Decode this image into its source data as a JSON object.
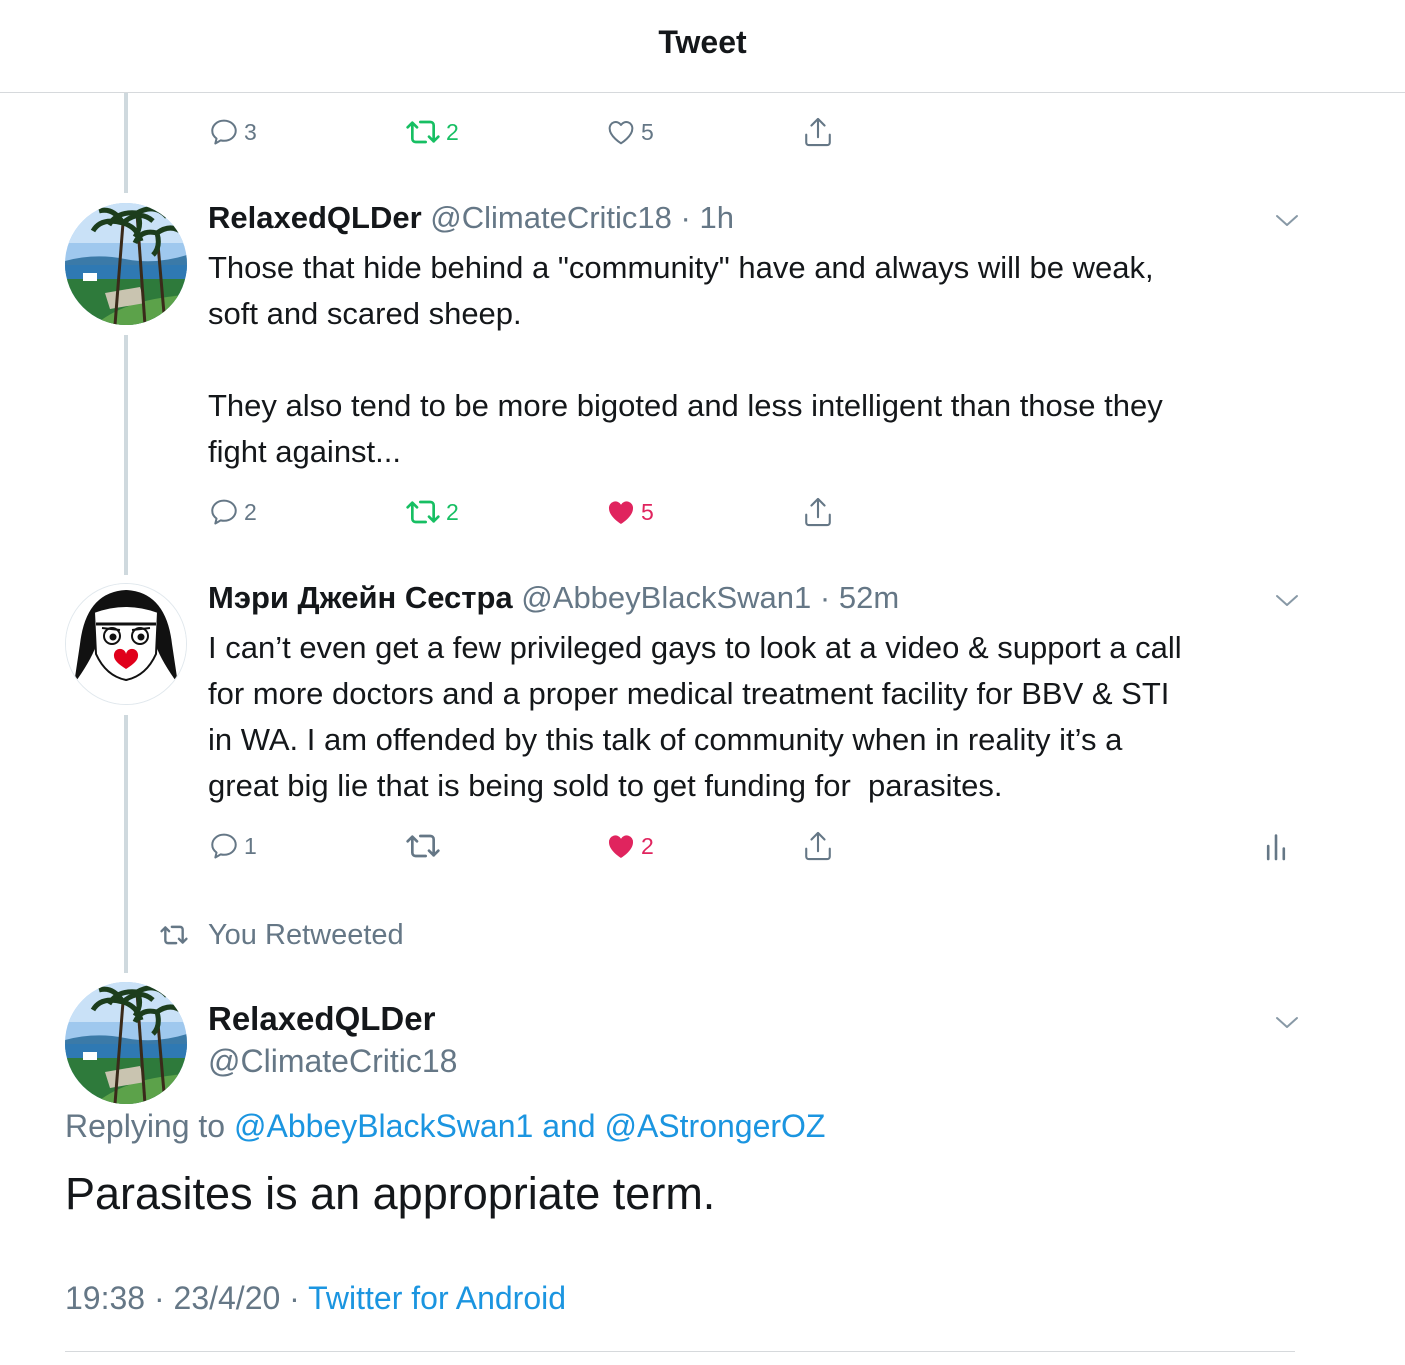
{
  "header": {
    "title": "Tweet"
  },
  "colors": {
    "link": "#1b95e0",
    "retweet_green": "#17bf63",
    "like_red": "#e0245e",
    "muted": "#657786"
  },
  "tweets": [
    {
      "actions": {
        "replies": "3",
        "retweets": "2",
        "likes": "5",
        "liked": false
      }
    },
    {
      "name": "RelaxedQLDer",
      "handle": "@ClimateCritic18",
      "dot": "·",
      "time": "1h",
      "avatar": "palm-beach-avatar",
      "text": [
        "Those that hide behind a \"community\" have and always will be weak,",
        "soft and scared sheep.",
        "",
        "They also tend to be more bigoted and less intelligent than those they",
        "fight against..."
      ],
      "actions": {
        "replies": "2",
        "retweets": "2",
        "likes": "5",
        "liked": true
      }
    },
    {
      "name": "Мэри Джейн Сестра",
      "handle": "@AbbeyBlackSwan1",
      "dot": "·",
      "time": "52m",
      "avatar": "nun-avatar",
      "text": [
        "I can’t even get a few privileged gays to look at a video & support a call",
        "for more doctors and a proper medical treatment facility for BBV & STI",
        "in WA. I am offended by this talk of community when in reality it’s a",
        "great big lie that is being sold to get funding for  parasites."
      ],
      "actions": {
        "replies": "1",
        "retweets": "",
        "likes": "2",
        "liked": true
      }
    }
  ],
  "retweet_label": "You Retweeted",
  "main_tweet": {
    "name": "RelaxedQLDer",
    "handle": "@ClimateCritic18",
    "replying_prefix": "Replying to ",
    "replying_user1": "@AbbeyBlackSwan1",
    "replying_and": " and ",
    "replying_user2": "@AStrongerOZ",
    "text": "Parasites is an appropriate term.",
    "time": "19:38",
    "sep": " · ",
    "date": "23/4/20",
    "source": "Twitter for Android"
  }
}
